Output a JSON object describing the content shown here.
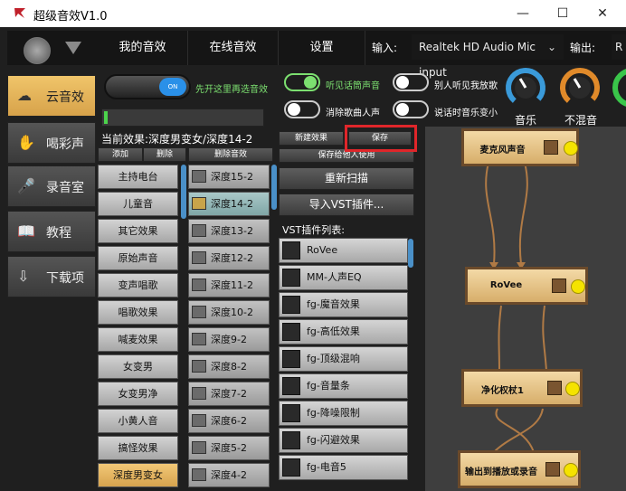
{
  "window": {
    "title": "超级音效V1.0",
    "min": "—",
    "max": "☐",
    "close": "✕"
  },
  "nav": {
    "tabs": [
      "我的音效",
      "在线音效",
      "设置"
    ],
    "input_label": "输入:",
    "input_value": "Realtek HD Audio Mic input",
    "output_label": "输出:",
    "output_value": "R"
  },
  "sidebar": {
    "items": [
      {
        "label": "云音效",
        "icon": "cloud-icon",
        "glyph": "☁",
        "active": true
      },
      {
        "label": "喝彩声",
        "icon": "clap-icon",
        "glyph": "✋",
        "active": false
      },
      {
        "label": "录音室",
        "icon": "microphone-icon",
        "glyph": "🎤",
        "active": false
      },
      {
        "label": "教程",
        "icon": "book-icon",
        "glyph": "📖",
        "active": false
      },
      {
        "label": "下载项",
        "icon": "download-icon",
        "glyph": "⇩",
        "active": false
      }
    ]
  },
  "power": {
    "state": "ON",
    "hint": "先开这里再选音效",
    "level": 0.02
  },
  "switches": [
    {
      "label": "听见话筒声音",
      "on": true
    },
    {
      "label": "消除歌曲人声",
      "on": false
    },
    {
      "label": "别人听见我放歌",
      "on": false
    },
    {
      "label": "说话时音乐变小",
      "on": false
    }
  ],
  "dials": [
    {
      "label": "音乐",
      "color": "#3a9ad9"
    },
    {
      "label": "不混音",
      "color": "#e08a2a"
    }
  ],
  "current_effect": "当前效果:深度男变女/深度14-2",
  "category_buttons": {
    "add": "添加",
    "delete": "删除",
    "delete_effect": "删除音效"
  },
  "categories": [
    "主持电台",
    "儿童音",
    "其它效果",
    "原始声音",
    "变声唱歌",
    "唱歌效果",
    "喊麦效果",
    "女变男",
    "女变男净",
    "小黄人音",
    "搞怪效果",
    "深度男变女"
  ],
  "selected_category": "深度男变女",
  "effects": [
    "深度15-2",
    "深度14-2",
    "深度13-2",
    "深度12-2",
    "深度11-2",
    "深度10-2",
    "深度9-2",
    "深度8-2",
    "深度7-2",
    "深度6-2",
    "深度5-2",
    "深度4-2"
  ],
  "selected_effect": "深度14-2",
  "effect_actions": {
    "new": "新建效果",
    "save": "保存",
    "save_share": "保存给他人使用"
  },
  "buttons": {
    "rescan": "重新扫描",
    "import_vst": "导入VST插件..."
  },
  "vst": {
    "title": "VST插件列表:",
    "items": [
      "RoVee",
      "MM-人声EQ",
      "fg-魔音效果",
      "fg-高低效果",
      "fg-顶级混响",
      "fg-音量条",
      "fg-降噪限制",
      "fg-闪避效果",
      "fg-电音5"
    ]
  },
  "graph_nodes": [
    "麦克风声音",
    "RoVee",
    "净化权杖1",
    "输出到播放或录音"
  ],
  "colors": {
    "accent": "#4a90c8",
    "active": "#e2b35c",
    "highlight": "#e0262a",
    "node_dot": "#f5e300"
  }
}
